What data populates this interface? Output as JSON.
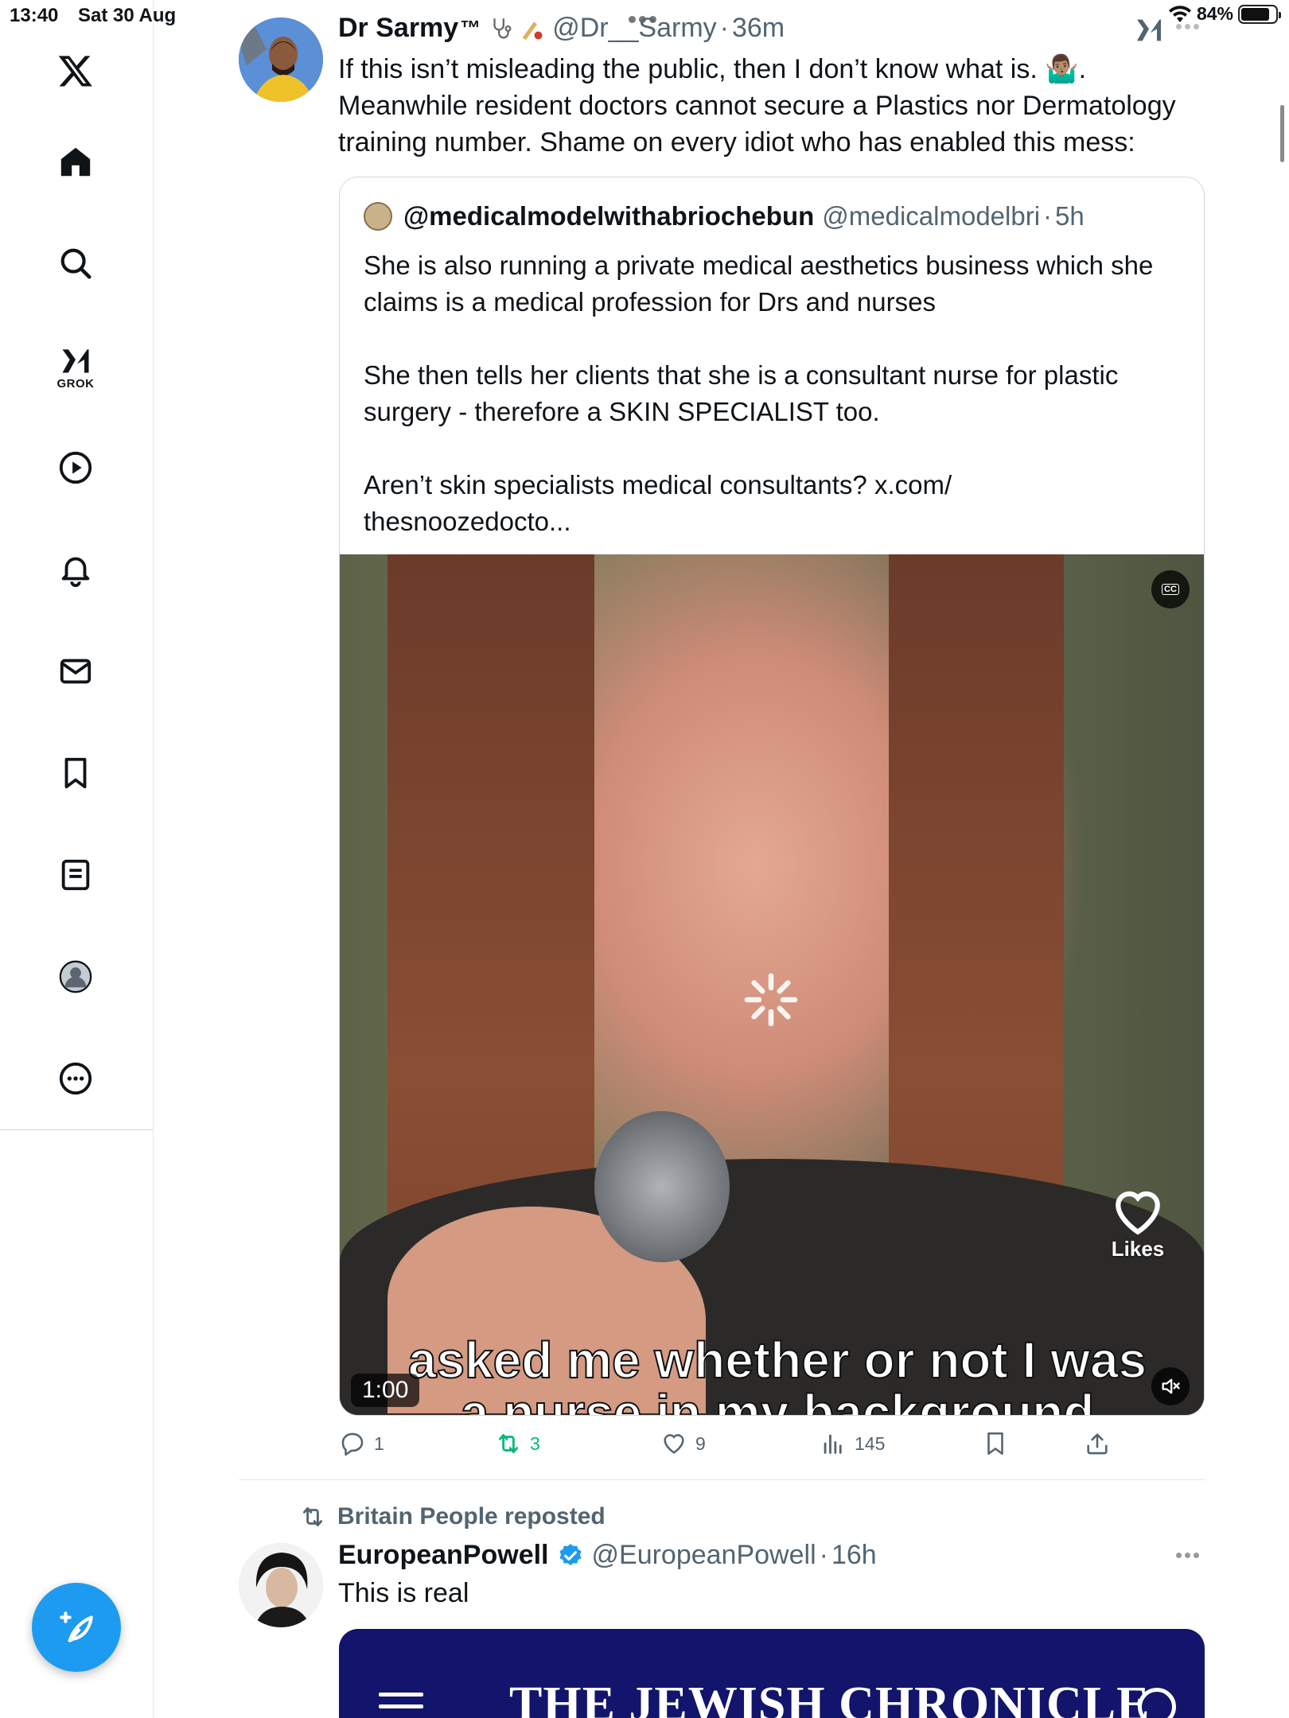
{
  "status_bar": {
    "time": "13:40",
    "date": "Sat 30 Aug",
    "battery": "84%",
    "battery_level": 0.84
  },
  "sidebar": {
    "items": [
      {
        "name": "x-logo-icon"
      },
      {
        "name": "home-icon"
      },
      {
        "name": "search-icon"
      },
      {
        "name": "grok-icon",
        "label": "GROK"
      },
      {
        "name": "video-icon"
      },
      {
        "name": "notifications-icon"
      },
      {
        "name": "messages-icon"
      },
      {
        "name": "bookmarks-icon"
      },
      {
        "name": "lists-icon"
      },
      {
        "name": "profile-icon"
      },
      {
        "name": "more-icon"
      }
    ],
    "compose_icon": "feather-plus-icon"
  },
  "tweet1": {
    "name": "Dr Sarmy",
    "name_suffix": "™",
    "handle": "@Dr__Sarmy",
    "sep": "·",
    "ago": "36m",
    "text": "If this isn’t misleading the public, then I don’t know what is. 🤷🏽‍♂️. Meanwhile resident doctors cannot secure a Plastics nor Dermatology training number. Shame on every idiot who has enabled this mess:",
    "quote": {
      "name": "@medicalmodelwithabriochebun",
      "handle": "@medicalmodelbri",
      "sep": "·",
      "ago": "5h",
      "text": "She is also running a private medical aesthetics business which she claims is a medical profession for Drs and nurses\n\nShe then tells her clients that she is a consultant nurse for plastic surgery - therefore a SKIN SPECIALIST too.\n\nAren’t skin specialists medical consultants? x.com/\nthesnoozedocto...",
      "video": {
        "cc_label": "CC",
        "likes_label": "Likes",
        "caption": "asked me whether or not I was\na nurse in my background",
        "duration": "1:00"
      }
    },
    "actions": {
      "replies": "1",
      "reposts": "3",
      "likes": "9",
      "views": "145"
    }
  },
  "tweet2": {
    "repost_label": "Britain People reposted",
    "name": "EuropeanPowell",
    "handle": "@EuropeanPowell",
    "sep": "·",
    "ago": "16h",
    "text": "This is real",
    "card_title": "THE JEWISH CHRONICLE"
  },
  "colors": {
    "accent": "#1d9bf0",
    "repost_green": "#00ba7c",
    "muted": "#536471",
    "jc_navy": "#12156b"
  }
}
